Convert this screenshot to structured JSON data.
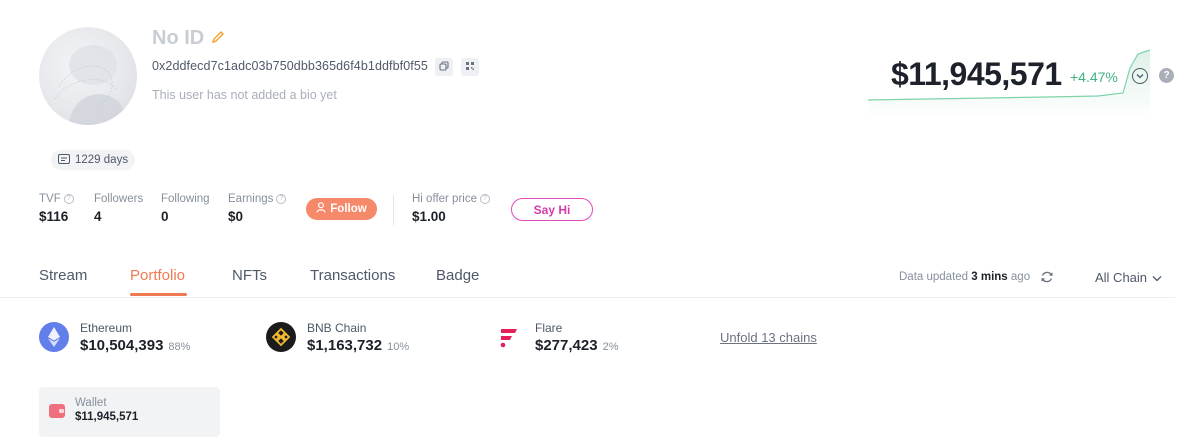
{
  "profile": {
    "name": "No ID",
    "address": "0x2ddfecd7c1adc03b750dbb365d6f4b1ddfbf0f55",
    "bio": "This user has not added a bio yet",
    "days": "1229 days"
  },
  "stats": {
    "tvf_label": "TVF",
    "tvf_value": "$116",
    "followers_label": "Followers",
    "followers_value": "4",
    "following_label": "Following",
    "following_value": "0",
    "earnings_label": "Earnings",
    "earnings_value": "$0",
    "follow_label": "Follow",
    "hi_offer_label": "Hi offer price",
    "hi_offer_value": "$1.00",
    "say_hi_label": "Say Hi"
  },
  "summary": {
    "total": "$11,945,571",
    "change": "+4.47%"
  },
  "tabs": [
    {
      "label": "Stream"
    },
    {
      "label": "Portfolio"
    },
    {
      "label": "NFTs"
    },
    {
      "label": "Transactions"
    },
    {
      "label": "Badge"
    }
  ],
  "active_tab": "Portfolio",
  "updated": {
    "prefix": "Data updated",
    "time": "3 mins",
    "suffix": "ago"
  },
  "chain_filter": "All Chain",
  "chains": [
    {
      "name": "Ethereum",
      "value": "$10,504,393",
      "pct": "88%"
    },
    {
      "name": "BNB Chain",
      "value": "$1,163,732",
      "pct": "10%"
    },
    {
      "name": "Flare",
      "value": "$277,423",
      "pct": "2%"
    }
  ],
  "unfold_label": "Unfold 13 chains",
  "wallet": {
    "label": "Wallet",
    "value": "$11,945,571"
  },
  "colors": {
    "accent": "#f07a52",
    "follow_button": "#f58969",
    "say_hi": "#d63ca9",
    "positive": "#3fb37f"
  }
}
